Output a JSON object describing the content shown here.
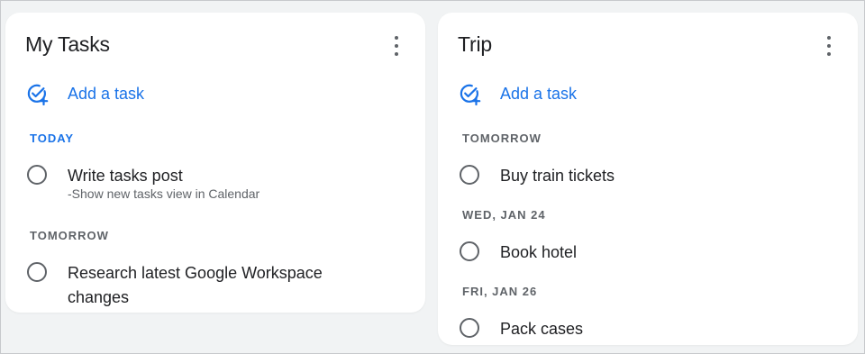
{
  "lists": [
    {
      "title": "My Tasks",
      "add_task_label": "Add a task",
      "sections": [
        {
          "label": "TODAY",
          "tasks": [
            {
              "title": "Write tasks post",
              "note": "-Show new tasks view in Calendar"
            }
          ]
        },
        {
          "label": "TOMORROW",
          "tasks": [
            {
              "title": "Research latest Google Workspace changes",
              "note": ""
            }
          ]
        }
      ]
    },
    {
      "title": "Trip",
      "add_task_label": "Add a task",
      "sections": [
        {
          "label": "TOMORROW",
          "tasks": [
            {
              "title": "Buy train tickets",
              "note": ""
            }
          ]
        },
        {
          "label": "WED, JAN 24",
          "tasks": [
            {
              "title": "Book hotel",
              "note": ""
            }
          ]
        },
        {
          "label": "FRI, JAN 26",
          "tasks": [
            {
              "title": "Pack cases",
              "note": ""
            }
          ]
        }
      ]
    }
  ],
  "icons": {
    "menu": "more-vert-icon",
    "add_task": "add-task-icon",
    "task_checkbox": "empty-circle-icon"
  },
  "colors": {
    "accent": "#1a73e8",
    "background": "#f1f3f4",
    "card": "#ffffff",
    "text": "#202124",
    "secondary_text": "#5f6368"
  }
}
